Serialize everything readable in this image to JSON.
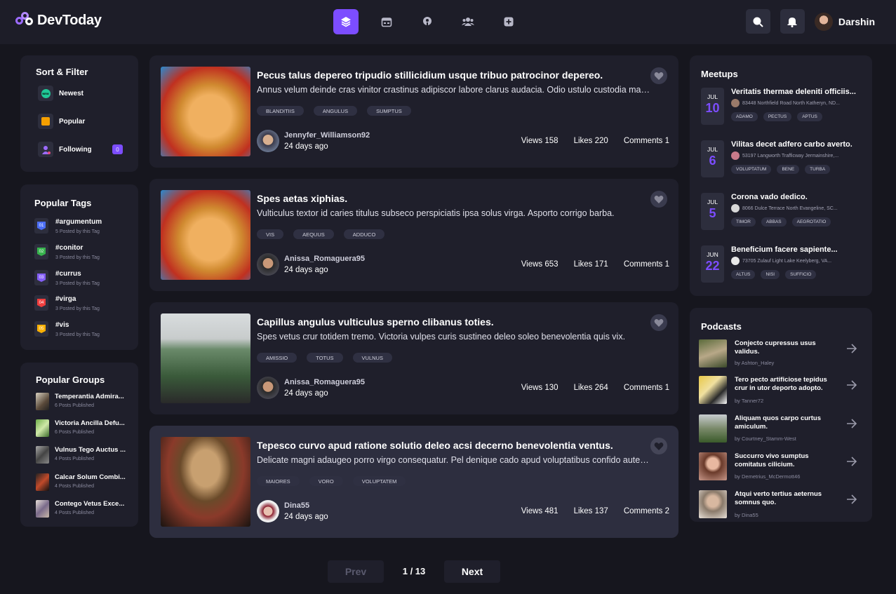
{
  "app": {
    "name": "DevToday"
  },
  "header": {
    "username": "Darshin"
  },
  "sort_filter": {
    "title": "Sort & Filter",
    "items": [
      {
        "label": "Newest",
        "icon": "new-icon"
      },
      {
        "label": "Popular",
        "icon": "fire-icon"
      },
      {
        "label": "Following",
        "icon": "user-icon",
        "badge": "0"
      }
    ]
  },
  "popular_tags": {
    "title": "Popular Tags",
    "items": [
      {
        "num": "01",
        "name": "#argumentum",
        "sub": "5 Posted by this Tag",
        "color": "#4c6ef5"
      },
      {
        "num": "02",
        "name": "#conitor",
        "sub": "3 Posted by this Tag",
        "color": "#37b24d"
      },
      {
        "num": "03",
        "name": "#currus",
        "sub": "3 Posted by this Tag",
        "color": "#845ef7"
      },
      {
        "num": "04",
        "name": "#virga",
        "sub": "3 Posted by this Tag",
        "color": "#f03e3e"
      },
      {
        "num": "05",
        "name": "#vis",
        "sub": "3 Posted by this Tag",
        "color": "#fab005"
      }
    ]
  },
  "popular_groups": {
    "title": "Popular Groups",
    "items": [
      {
        "name": "Temperantia Admira...",
        "sub": "6 Posts Published"
      },
      {
        "name": "Victoria Ancilla Defu...",
        "sub": "6 Posts Published"
      },
      {
        "name": "Vulnus Tego Auctus ...",
        "sub": "4 Posts Published"
      },
      {
        "name": "Calcar Solum Combi...",
        "sub": "4 Posts Published"
      },
      {
        "name": "Contego Vetus Exce...",
        "sub": "4 Posts Published"
      }
    ]
  },
  "posts": [
    {
      "title": "Pecus talus depereo tripudio stillicidium usque tribuo patrocinor depereo.",
      "desc": "Annus velum deinde cras vinitor crastinus adipiscor labore clarus audacia. Odio ustulo custodia maxime cupio.",
      "tags": [
        "BLANDITIIS",
        "ANGULUS",
        "SUMPTUS"
      ],
      "author": "Jennyfer_Williamson92",
      "date": "24 days ago",
      "views": "Views 158",
      "likes": "Likes 220",
      "comments": "Comments 1"
    },
    {
      "title": "Spes aetas xiphias.",
      "desc": "Vulticulus textor id caries titulus subseco perspiciatis ipsa solus virga. Asporto corrigo barba.",
      "tags": [
        "VIS",
        "AEQUUS",
        "ADDUCO"
      ],
      "author": "Anissa_Romaguera95",
      "date": "24 days ago",
      "views": "Views 653",
      "likes": "Likes 171",
      "comments": "Comments 1"
    },
    {
      "title": "Capillus angulus vulticulus sperno clibanus toties.",
      "desc": "Spes vetus crur totidem tremo. Victoria vulpes curis sustineo deleo soleo benevolentia quis vix.",
      "tags": [
        "AMISSIO",
        "TOTUS",
        "VULNUS"
      ],
      "author": "Anissa_Romaguera95",
      "date": "24 days ago",
      "views": "Views 130",
      "likes": "Likes 264",
      "comments": "Comments 1"
    },
    {
      "title": "Tepesco curvo apud ratione solutio deleo acsi decerno benevolentia ventus.",
      "desc": "Delicate magni adaugeo porro virgo consequatur. Pel denique cado apud voluptatibus confido autem vero.",
      "tags": [
        "MAIORES",
        "VORO",
        "VOLUPTATEM"
      ],
      "author": "Dina55",
      "date": "24 days ago",
      "views": "Views 481",
      "likes": "Likes 137",
      "comments": "Comments 2"
    }
  ],
  "pagination": {
    "prev": "Prev",
    "page": "1 / 13",
    "next": "Next"
  },
  "meetups": {
    "title": "Meetups",
    "items": [
      {
        "month": "JUL",
        "day": "10",
        "title": "Veritatis thermae deleniti officiis...",
        "addr": "83448 Northfield Road North Katheryn, ND...",
        "tags": [
          "ADAMO",
          "PECTUS",
          "APTUS"
        ]
      },
      {
        "month": "JUL",
        "day": "6",
        "title": "Vilitas decet adfero carbo averto.",
        "addr": "53197 Langworth Trafficway Jermainshire,...",
        "tags": [
          "VOLUPTATUM",
          "BENE",
          "TURBA"
        ]
      },
      {
        "month": "JUL",
        "day": "5",
        "title": "Corona vado dedico.",
        "addr": "8066 Dulce Terrace North Evangeline, SC...",
        "tags": [
          "TIMOR",
          "ABBAS",
          "AEGROTATIO"
        ]
      },
      {
        "month": "JUN",
        "day": "22",
        "title": "Beneficium facere sapiente...",
        "addr": "73705 Zulauf Light Lake Keelyberg, VA...",
        "tags": [
          "ALTUS",
          "NISI",
          "SUFFICIO"
        ]
      }
    ]
  },
  "podcasts": {
    "title": "Podcasts",
    "items": [
      {
        "title": "Conjecto cupressus usus validus.",
        "by": "by Ashton_Haley"
      },
      {
        "title": "Tero pecto artificiose tepidus crur in utor deporto adopto.",
        "by": "by Tanner72"
      },
      {
        "title": "Aliquam quos carpo curtus amiculum.",
        "by": "by Courtney_Stamm-West"
      },
      {
        "title": "Succurro vivo sumptus comitatus cilicium.",
        "by": "by Demetrius_McDermott46"
      },
      {
        "title": "Atqui verto tertius aeternus somnus quo.",
        "by": "by Dina55"
      }
    ]
  }
}
